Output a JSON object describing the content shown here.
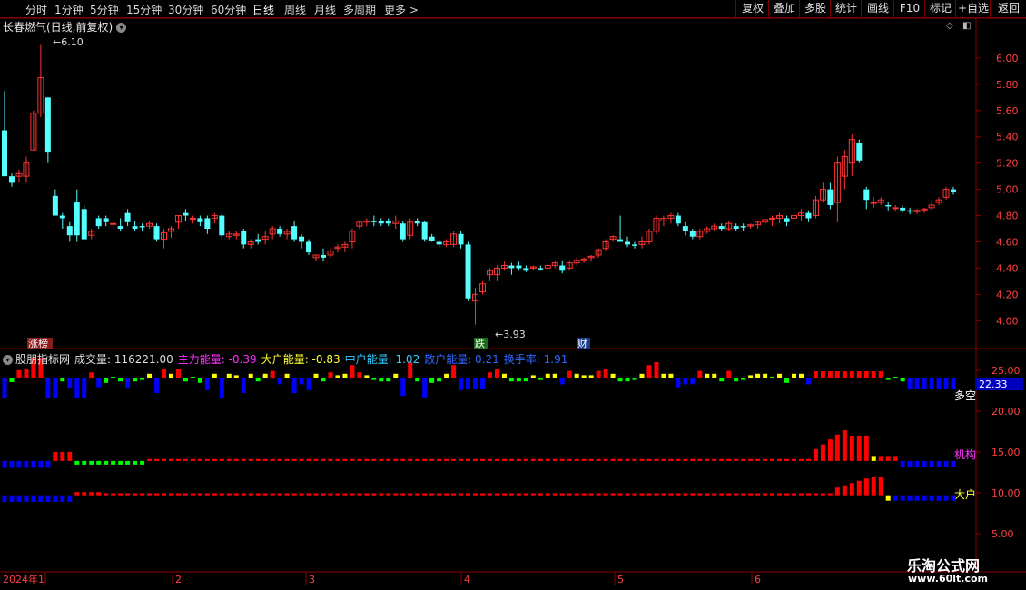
{
  "toolbar": {
    "periods": [
      "分时",
      "1分钟",
      "5分钟",
      "15分钟",
      "30分钟",
      "60分钟",
      "日线",
      "周线",
      "月线",
      "多周期",
      "更多 >"
    ],
    "active_period": "日线",
    "right_buttons": [
      "复权",
      "叠加",
      "多股",
      "统计",
      "画线",
      "F10",
      "标记",
      "+自选",
      "返回"
    ]
  },
  "stock": {
    "title": "长春燃气(日线,前复权)",
    "high_label": "6.10",
    "low_label": "3.93"
  },
  "events": {
    "zhangbang": "涨榜",
    "die": "跌",
    "cai": "财"
  },
  "indicator": {
    "name": "股朋指标网",
    "items": [
      {
        "label": "成交量: 116221.00",
        "color": "#dddddd"
      },
      {
        "label": "主力能量: -0.39",
        "color": "#ff33ff"
      },
      {
        "label": "大户能量: -0.83",
        "color": "#ffff33"
      },
      {
        "label": "中户能量: 1.02",
        "color": "#33ccff"
      },
      {
        "label": "散户能量: 0.21",
        "color": "#3366ff"
      },
      {
        "label": "换手率: 1.91",
        "color": "#3366ff"
      }
    ],
    "side_labels": {
      "duokong": "多空",
      "jigou": "机构",
      "dahu": "大户"
    },
    "current_value": "22.33"
  },
  "price_axis": [
    "6.00",
    "5.80",
    "5.60",
    "5.40",
    "5.20",
    "5.00",
    "4.80",
    "4.60",
    "4.40",
    "4.20",
    "4.00"
  ],
  "ind_axis": [
    "25.00",
    "20.00",
    "15.00",
    "10.00",
    "5.00"
  ],
  "date_axis": {
    "year": "2024年1",
    "months": [
      "2",
      "3",
      "4",
      "5",
      "6"
    ]
  },
  "watermark": {
    "line1": "乐淘公式网",
    "line2": "www.60lt.com"
  },
  "colors": {
    "up": "#ff3333",
    "down": "#54ffff",
    "frame": "#8b0000",
    "blue": "#0000ff",
    "green": "#00ff00",
    "yellow": "#ffff00",
    "red": "#ff0000"
  },
  "chart_data": {
    "type": "candlestick",
    "ylim": [
      3.85,
      6.2
    ],
    "candles": [
      [
        5.45,
        5.75,
        5.1,
        5.1
      ],
      [
        5.1,
        5.12,
        5.02,
        5.05
      ],
      [
        5.1,
        5.15,
        5.05,
        5.12
      ],
      [
        5.1,
        5.25,
        5.05,
        5.2
      ],
      [
        5.3,
        5.6,
        5.3,
        5.58
      ],
      [
        5.58,
        6.1,
        5.55,
        5.85
      ],
      [
        5.7,
        5.7,
        5.2,
        5.28
      ],
      [
        4.95,
        5.0,
        4.85,
        4.8
      ],
      [
        4.8,
        4.82,
        4.7,
        4.78
      ],
      [
        4.72,
        4.75,
        4.6,
        4.65
      ],
      [
        4.9,
        5.0,
        4.6,
        4.65
      ],
      [
        4.85,
        4.88,
        4.62,
        4.62
      ],
      [
        4.65,
        4.7,
        4.62,
        4.68
      ],
      [
        4.78,
        4.8,
        4.7,
        4.72
      ],
      [
        4.78,
        4.8,
        4.72,
        4.75
      ],
      [
        4.74,
        4.77,
        4.7,
        4.74
      ],
      [
        4.72,
        4.78,
        4.68,
        4.7
      ],
      [
        4.82,
        4.85,
        4.72,
        4.75
      ],
      [
        4.72,
        4.76,
        4.68,
        4.7
      ],
      [
        4.72,
        4.74,
        4.68,
        4.71
      ],
      [
        4.72,
        4.76,
        4.7,
        4.74
      ],
      [
        4.72,
        4.74,
        4.6,
        4.62
      ],
      [
        4.62,
        4.7,
        4.55,
        4.67
      ],
      [
        4.68,
        4.72,
        4.63,
        4.7
      ],
      [
        4.75,
        4.8,
        4.7,
        4.8
      ],
      [
        4.82,
        4.85,
        4.76,
        4.8
      ],
      [
        4.78,
        4.8,
        4.74,
        4.78
      ],
      [
        4.78,
        4.8,
        4.72,
        4.75
      ],
      [
        4.78,
        4.8,
        4.66,
        4.7
      ],
      [
        4.78,
        4.82,
        4.74,
        4.8
      ],
      [
        4.8,
        4.82,
        4.62,
        4.65
      ],
      [
        4.64,
        4.68,
        4.62,
        4.66
      ],
      [
        4.65,
        4.68,
        4.62,
        4.66
      ],
      [
        4.68,
        4.7,
        4.55,
        4.58
      ],
      [
        4.58,
        4.62,
        4.55,
        4.6
      ],
      [
        4.62,
        4.66,
        4.58,
        4.6
      ],
      [
        4.62,
        4.68,
        4.58,
        4.64
      ],
      [
        4.66,
        4.72,
        4.62,
        4.7
      ],
      [
        4.7,
        4.72,
        4.64,
        4.66
      ],
      [
        4.66,
        4.7,
        4.62,
        4.68
      ],
      [
        4.72,
        4.76,
        4.6,
        4.62
      ],
      [
        4.64,
        4.66,
        4.55,
        4.6
      ],
      [
        4.6,
        4.62,
        4.5,
        4.52
      ],
      [
        4.48,
        4.5,
        4.45,
        4.5
      ],
      [
        4.5,
        4.55,
        4.45,
        4.48
      ],
      [
        4.5,
        4.55,
        4.48,
        4.53
      ],
      [
        4.55,
        4.58,
        4.52,
        4.56
      ],
      [
        4.56,
        4.6,
        4.52,
        4.58
      ],
      [
        4.6,
        4.7,
        4.55,
        4.68
      ],
      [
        4.72,
        4.76,
        4.7,
        4.75
      ],
      [
        4.75,
        4.78,
        4.72,
        4.76
      ],
      [
        4.76,
        4.8,
        4.72,
        4.75
      ],
      [
        4.76,
        4.78,
        4.72,
        4.74
      ],
      [
        4.76,
        4.78,
        4.72,
        4.74
      ],
      [
        4.74,
        4.8,
        4.7,
        4.76
      ],
      [
        4.74,
        4.76,
        4.6,
        4.62
      ],
      [
        4.65,
        4.78,
        4.62,
        4.75
      ],
      [
        4.76,
        4.78,
        4.72,
        4.74
      ],
      [
        4.75,
        4.76,
        4.6,
        4.62
      ],
      [
        4.64,
        4.66,
        4.6,
        4.61
      ],
      [
        4.6,
        4.62,
        4.55,
        4.58
      ],
      [
        4.58,
        4.62,
        4.56,
        4.6
      ],
      [
        4.58,
        4.68,
        4.56,
        4.66
      ],
      [
        4.66,
        4.68,
        4.55,
        4.58
      ],
      [
        4.58,
        4.6,
        4.15,
        4.17
      ],
      [
        4.15,
        4.25,
        3.97,
        4.2
      ],
      [
        4.22,
        4.3,
        4.2,
        4.28
      ],
      [
        4.35,
        4.4,
        4.3,
        4.38
      ],
      [
        4.35,
        4.42,
        4.3,
        4.4
      ],
      [
        4.4,
        4.45,
        4.38,
        4.42
      ],
      [
        4.42,
        4.44,
        4.35,
        4.4
      ],
      [
        4.42,
        4.45,
        4.38,
        4.4
      ],
      [
        4.4,
        4.42,
        4.37,
        4.38
      ],
      [
        4.4,
        4.42,
        4.38,
        4.41
      ],
      [
        4.4,
        4.42,
        4.38,
        4.39
      ],
      [
        4.4,
        4.43,
        4.38,
        4.42
      ],
      [
        4.42,
        4.45,
        4.4,
        4.44
      ],
      [
        4.42,
        4.46,
        4.36,
        4.38
      ],
      [
        4.4,
        4.46,
        4.38,
        4.44
      ],
      [
        4.44,
        4.48,
        4.42,
        4.46
      ],
      [
        4.46,
        4.48,
        4.44,
        4.47
      ],
      [
        4.48,
        4.5,
        4.45,
        4.49
      ],
      [
        4.5,
        4.55,
        4.48,
        4.54
      ],
      [
        4.55,
        4.62,
        4.53,
        4.6
      ],
      [
        4.62,
        4.65,
        4.6,
        4.64
      ],
      [
        4.62,
        4.8,
        4.6,
        4.6
      ],
      [
        4.6,
        4.64,
        4.56,
        4.58
      ],
      [
        4.58,
        4.6,
        4.55,
        4.57
      ],
      [
        4.58,
        4.64,
        4.55,
        4.6
      ],
      [
        4.6,
        4.7,
        4.58,
        4.68
      ],
      [
        4.68,
        4.8,
        4.66,
        4.78
      ],
      [
        4.76,
        4.8,
        4.72,
        4.78
      ],
      [
        4.78,
        4.82,
        4.74,
        4.8
      ],
      [
        4.8,
        4.82,
        4.72,
        4.74
      ],
      [
        4.72,
        4.75,
        4.65,
        4.68
      ],
      [
        4.68,
        4.7,
        4.62,
        4.64
      ],
      [
        4.64,
        4.7,
        4.62,
        4.68
      ],
      [
        4.68,
        4.72,
        4.66,
        4.7
      ],
      [
        4.7,
        4.74,
        4.68,
        4.72
      ],
      [
        4.72,
        4.74,
        4.68,
        4.7
      ],
      [
        4.7,
        4.76,
        4.68,
        4.74
      ],
      [
        4.72,
        4.74,
        4.68,
        4.7
      ],
      [
        4.72,
        4.74,
        4.68,
        4.71
      ],
      [
        4.72,
        4.74,
        4.7,
        4.73
      ],
      [
        4.73,
        4.76,
        4.7,
        4.75
      ],
      [
        4.75,
        4.78,
        4.72,
        4.77
      ],
      [
        4.78,
        4.8,
        4.72,
        4.78
      ],
      [
        4.78,
        4.82,
        4.74,
        4.8
      ],
      [
        4.78,
        4.8,
        4.72,
        4.75
      ],
      [
        4.78,
        4.82,
        4.74,
        4.8
      ],
      [
        4.8,
        4.85,
        4.76,
        4.82
      ],
      [
        4.82,
        4.84,
        4.75,
        4.78
      ],
      [
        4.8,
        4.95,
        4.78,
        4.92
      ],
      [
        4.92,
        5.05,
        4.9,
        5.0
      ],
      [
        5.0,
        5.05,
        4.85,
        4.88
      ],
      [
        4.9,
        5.25,
        4.75,
        5.2
      ],
      [
        5.1,
        5.3,
        5.0,
        5.25
      ],
      [
        5.2,
        5.42,
        5.1,
        5.38
      ],
      [
        5.35,
        5.38,
        5.2,
        5.22
      ],
      [
        5.0,
        5.02,
        4.85,
        4.92
      ],
      [
        4.9,
        4.94,
        4.86,
        4.9
      ],
      [
        4.9,
        4.94,
        4.88,
        4.92
      ],
      [
        4.88,
        4.9,
        4.84,
        4.87
      ],
      [
        4.86,
        4.88,
        4.83,
        4.86
      ],
      [
        4.86,
        4.88,
        4.82,
        4.84
      ],
      [
        4.84,
        4.86,
        4.81,
        4.83
      ],
      [
        4.83,
        4.85,
        4.81,
        4.84
      ],
      [
        4.84,
        4.86,
        4.82,
        4.85
      ],
      [
        4.86,
        4.9,
        4.84,
        4.88
      ],
      [
        4.9,
        4.94,
        4.88,
        4.92
      ],
      [
        4.94,
        5.02,
        4.92,
        5.0
      ],
      [
        5.0,
        5.02,
        4.96,
        4.98
      ]
    ],
    "bars_top_25": [
      {
        "v": -1,
        "c": "green"
      },
      {
        "v": -1,
        "c": "green"
      },
      {
        "v": -2,
        "c": "blue"
      },
      {
        "v": -2,
        "c": "blue"
      },
      {
        "v": 0.3,
        "c": "red"
      },
      {
        "v": 0.5,
        "c": "red"
      },
      {
        "v": 0.3,
        "c": "red"
      },
      {
        "v": -1,
        "c": "green"
      },
      {
        "v": -1,
        "c": "green"
      },
      {
        "v": -2,
        "c": "blue"
      },
      {
        "v": -1.5,
        "c": "blue"
      },
      {
        "v": -1,
        "c": "green"
      }
    ],
    "bars_top_25_note": "value range 25 at top",
    "bars_mid_15": [
      {
        "v": -2,
        "c": "blue"
      },
      {
        "v": -2,
        "c": "blue"
      },
      {
        "v": -2,
        "c": "green"
      },
      {
        "v": -1,
        "c": "blue"
      },
      {
        "v": 1,
        "c": "red"
      },
      {
        "v": 1.5,
        "c": "red"
      },
      {
        "v": 2,
        "c": "red"
      },
      {
        "v": -1,
        "c": "green"
      }
    ],
    "bars_low_10": [
      {
        "v": -1.5,
        "c": "green"
      },
      {
        "v": -1.5,
        "c": "blue"
      },
      {
        "v": -1.5,
        "c": "blue"
      },
      {
        "v": 0.5,
        "c": "red"
      }
    ]
  }
}
